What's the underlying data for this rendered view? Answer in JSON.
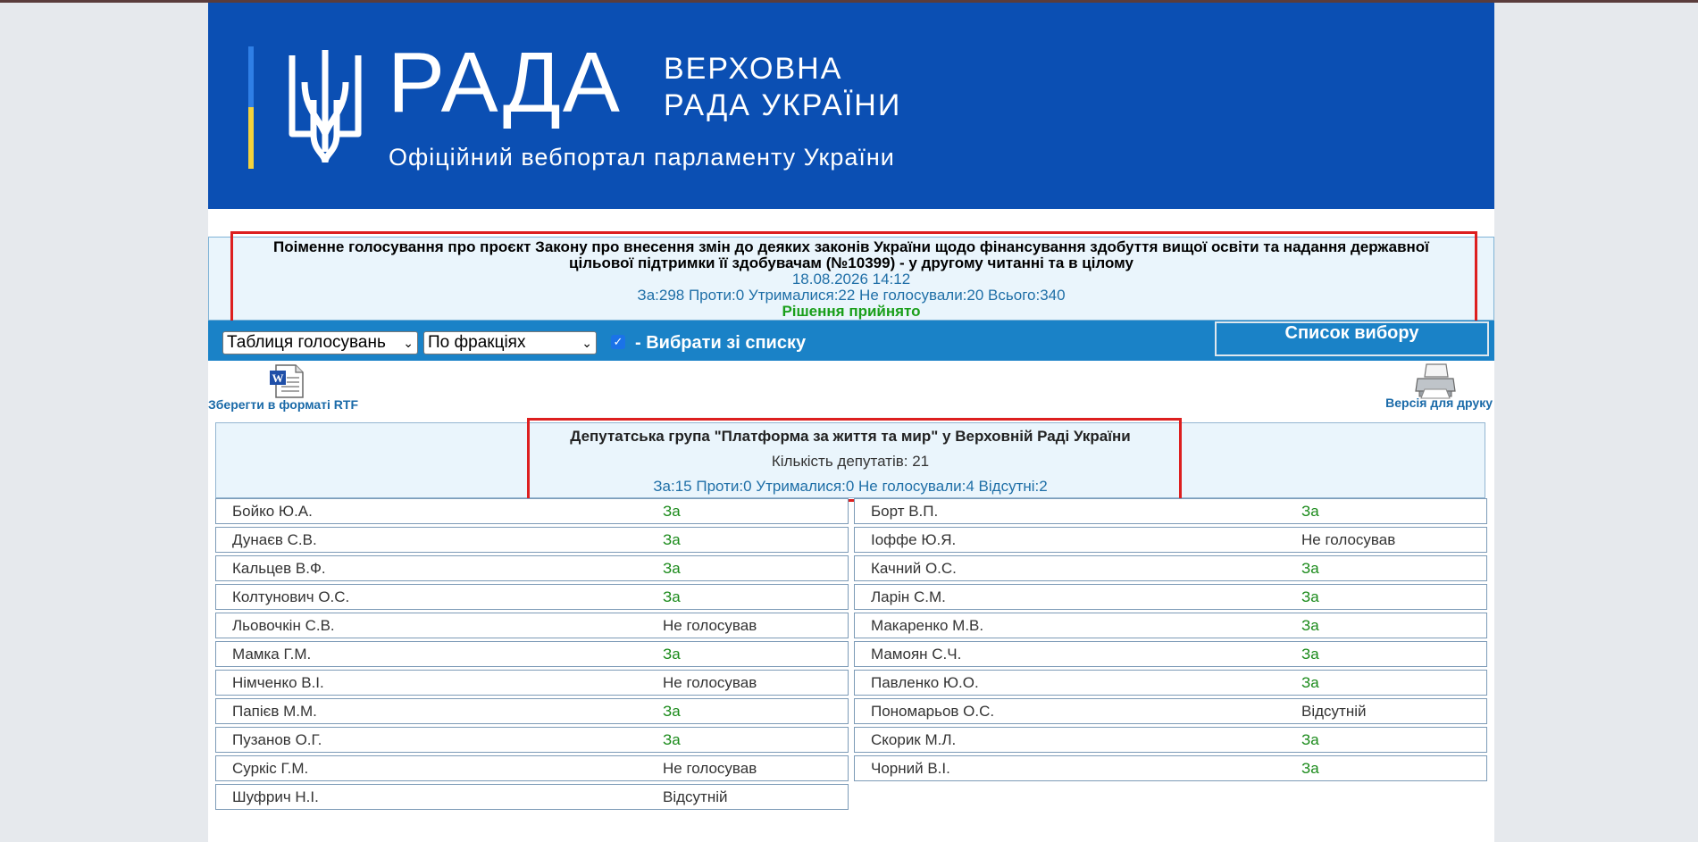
{
  "header": {
    "logo_word": "РАДА",
    "logo_sub_line1": "ВЕРХОВНА",
    "logo_sub_line2": "РАДА УКРАЇНИ",
    "tagline": "Офіційний вебпортал парламенту України"
  },
  "vote": {
    "title": "Поіменне голосування про проєкт Закону про внесення змін до деяких законів України щодо фінансування здобуття вищої освіти та надання державної цільової підтримки її здобувачам (№10399) - у другому читанні та в цілому",
    "datetime": "18.08.2026 14:12",
    "summary": "За:298 Проти:0 Утрималися:22 Не голосували:20 Всього:340",
    "result": "Рішення прийнято"
  },
  "toolbar": {
    "view_select": "Таблиця голосувань",
    "group_select": "По фракціях",
    "checkbox_label": "- Вибрати зі списку",
    "list_button": "Список вибору"
  },
  "links": {
    "rtf": "Зберегти в форматі RTF",
    "print": "Версія для друку"
  },
  "group": {
    "title": "Депутатська група \"Платформа за життя та мир\" у Верховній Раді України",
    "count": "Кількість депутатів: 21",
    "summary": "За:15 Проти:0 Утрималися:0 Не голосували:4 Відсутні:2"
  },
  "colors": {
    "header_blue": "#0b4fb3",
    "toolbar_blue": "#1a82c7",
    "vote_for_green": "#1a8a1a",
    "highlight_red": "#dd1f1f"
  },
  "deputies_left": [
    {
      "name": "Бойко Ю.А.",
      "vote": "За"
    },
    {
      "name": "Дунаєв С.В.",
      "vote": "За"
    },
    {
      "name": "Кальцев В.Ф.",
      "vote": "За"
    },
    {
      "name": "Колтунович О.С.",
      "vote": "За"
    },
    {
      "name": "Льовочкін С.В.",
      "vote": "Не голосував"
    },
    {
      "name": "Мамка Г.М.",
      "vote": "За"
    },
    {
      "name": "Німченко В.І.",
      "vote": "Не голосував"
    },
    {
      "name": "Папієв М.М.",
      "vote": "За"
    },
    {
      "name": "Пузанов О.Г.",
      "vote": "За"
    },
    {
      "name": "Суркіс Г.М.",
      "vote": "Не голосував"
    },
    {
      "name": "Шуфрич Н.І.",
      "vote": "Відсутній"
    }
  ],
  "deputies_right": [
    {
      "name": "Борт В.П.",
      "vote": "За"
    },
    {
      "name": "Іоффе Ю.Я.",
      "vote": "Не голосував"
    },
    {
      "name": "Качний О.С.",
      "vote": "За"
    },
    {
      "name": "Ларін С.М.",
      "vote": "За"
    },
    {
      "name": "Макаренко М.В.",
      "vote": "За"
    },
    {
      "name": "Мамоян С.Ч.",
      "vote": "За"
    },
    {
      "name": "Павленко Ю.О.",
      "vote": "За"
    },
    {
      "name": "Пономарьов О.С.",
      "vote": "Відсутній"
    },
    {
      "name": "Скорик М.Л.",
      "vote": "За"
    },
    {
      "name": "Чорний В.І.",
      "vote": "За"
    }
  ]
}
